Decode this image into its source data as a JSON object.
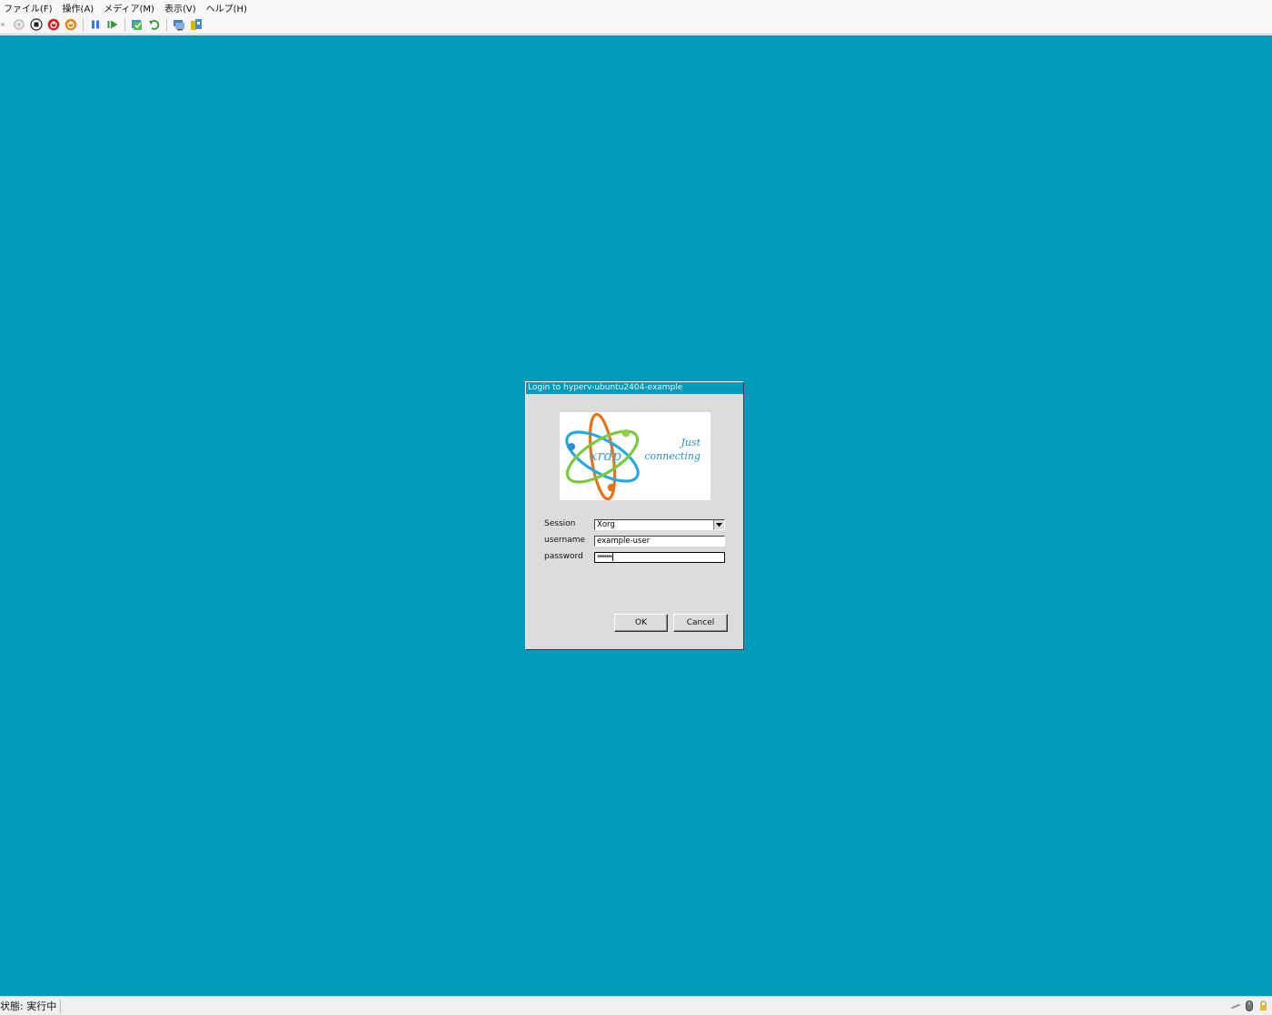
{
  "menu": {
    "file": "ファイル(F)",
    "action": "操作(A)",
    "media": "メディア(M)",
    "view": "表示(V)",
    "help": "ヘルプ(H)"
  },
  "toolbar": {
    "icons": [
      "ctrl-alt-del-icon",
      "start-icon",
      "turn-off-icon",
      "shutdown-icon",
      "save-icon",
      "pause-icon",
      "resume-icon",
      "checkpoint-icon",
      "revert-icon",
      "enhanced-session-icon",
      "share-icon"
    ]
  },
  "dialog": {
    "title": "Login to hyperv-ubuntu2404-example",
    "logo": {
      "name": "xrdp",
      "tagline_1": "Just",
      "tagline_2": "connecting"
    },
    "session_label": "Session",
    "session_value": "Xorg",
    "username_label": "username",
    "username_value": "example-user",
    "password_label": "password",
    "password_value": "********",
    "ok_label": "OK",
    "cancel_label": "Cancel"
  },
  "status": {
    "text": "状態: 実行中"
  },
  "colors": {
    "desktop": "#009bb8",
    "dialog_bg": "#dcdcdc",
    "title_bar": "#009bb8"
  }
}
